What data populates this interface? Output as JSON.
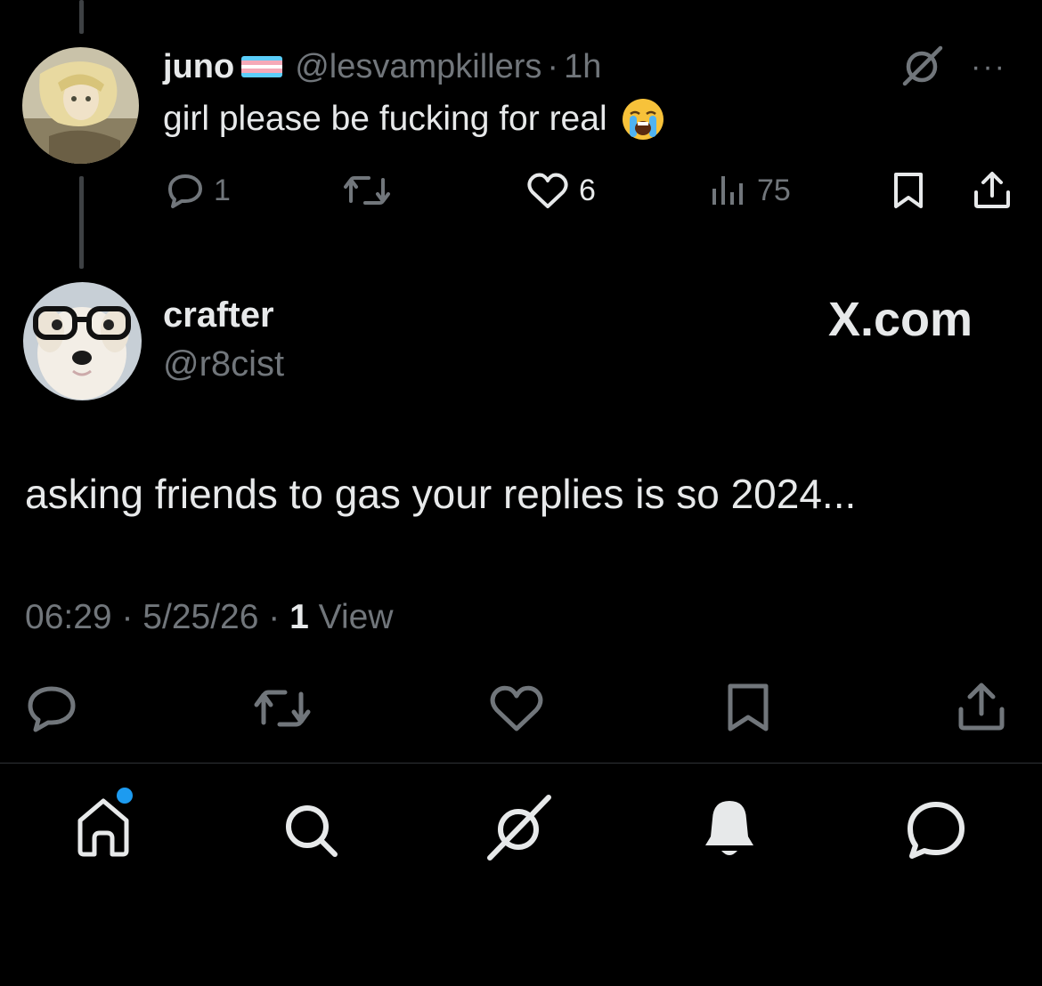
{
  "parent_tweet": {
    "display_name": "juno",
    "handle": "@lesvampkillers",
    "separator": "·",
    "time": "1h",
    "text": "girl please be fucking for real",
    "emoji": "loudly-crying-face",
    "more": "···",
    "stats": {
      "replies": "1",
      "likes": "6",
      "views": "75"
    }
  },
  "main_tweet": {
    "display_name": "crafter",
    "handle": "@r8cist",
    "brand": "X.com",
    "text": "asking friends to gas your replies is so 2024...",
    "meta_time": "06:29",
    "meta_date": "5/25/26",
    "meta_separator": "·",
    "view_count": "1",
    "view_label": "View"
  },
  "bottom_nav": {
    "items": [
      "home-icon",
      "search-icon",
      "grok-icon",
      "notifications-icon",
      "messages-icon"
    ],
    "home_has_unread": true
  },
  "colors": {
    "background": "#000000",
    "text": "#e7e9ea",
    "muted": "#71767b",
    "accent": "#1d9bf0",
    "divider": "#2f3336"
  }
}
